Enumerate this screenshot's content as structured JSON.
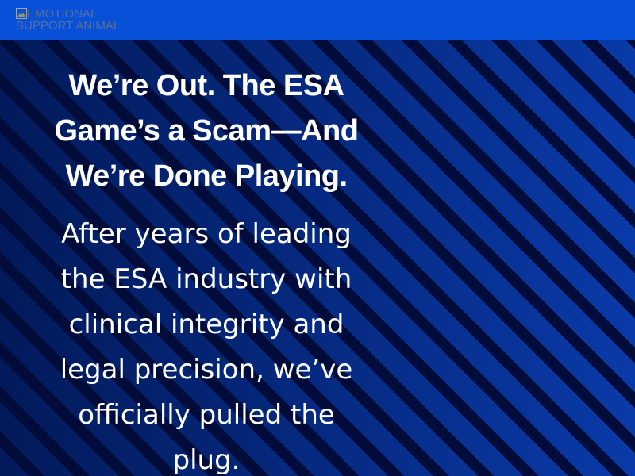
{
  "header": {
    "logo_alt": "EMOTIONAL SUPPORT ANIMAL",
    "background_color": "#0850d8"
  },
  "hero": {
    "title": "We’re Out. The ESA Game’s a Scam—And We’re Done Playing.",
    "body": "After years of leading the ESA industry with clinical integrity and legal precision, we’ve officially pulled the plug.",
    "text_color": "#ffffff",
    "background_colors": [
      "#021a5a",
      "#0a3aa8",
      "#020c3a"
    ]
  }
}
